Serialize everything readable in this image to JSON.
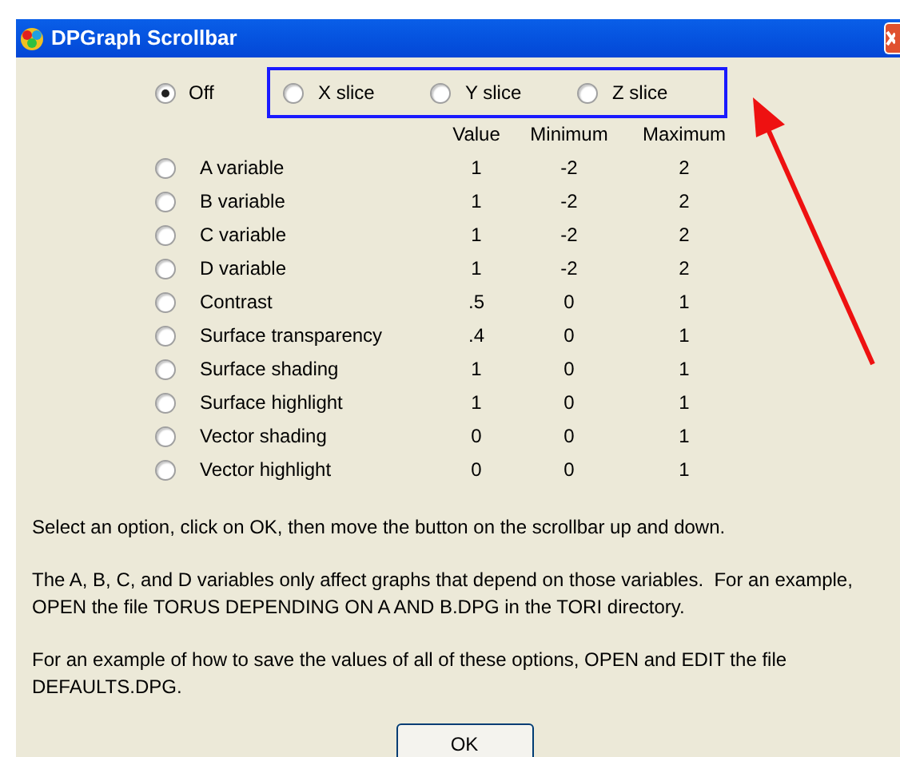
{
  "window": {
    "title": "DPGraph Scrollbar"
  },
  "off_option": {
    "label": "Off",
    "selected": true
  },
  "slice_options": [
    {
      "label": "X slice",
      "selected": false
    },
    {
      "label": "Y slice",
      "selected": false
    },
    {
      "label": "Z slice",
      "selected": false
    }
  ],
  "table": {
    "columns": [
      "Value",
      "Minimum",
      "Maximum"
    ],
    "rows": [
      {
        "label": "A variable",
        "selected": false,
        "value": "1",
        "minimum": "-2",
        "maximum": "2"
      },
      {
        "label": "B variable",
        "selected": false,
        "value": "1",
        "minimum": "-2",
        "maximum": "2"
      },
      {
        "label": "C variable",
        "selected": false,
        "value": "1",
        "minimum": "-2",
        "maximum": "2"
      },
      {
        "label": "D variable",
        "selected": false,
        "value": "1",
        "minimum": "-2",
        "maximum": "2"
      },
      {
        "label": "Contrast",
        "selected": false,
        "value": ".5",
        "minimum": "0",
        "maximum": "1"
      },
      {
        "label": "Surface transparency",
        "selected": false,
        "value": ".4",
        "minimum": "0",
        "maximum": "1"
      },
      {
        "label": "Surface shading",
        "selected": false,
        "value": "1",
        "minimum": "0",
        "maximum": "1"
      },
      {
        "label": "Surface highlight",
        "selected": false,
        "value": "1",
        "minimum": "0",
        "maximum": "1"
      },
      {
        "label": "Vector shading",
        "selected": false,
        "value": "0",
        "minimum": "0",
        "maximum": "1"
      },
      {
        "label": "Vector highlight",
        "selected": false,
        "value": "0",
        "minimum": "0",
        "maximum": "1"
      }
    ]
  },
  "paragraphs": [
    "Select an option, click on OK, then move the button on the scrollbar up and down.",
    "The A, B, C, and D variables only affect graphs that depend on those variables.  For an example, OPEN the file TORUS DEPENDING ON A AND B.DPG in the TORI directory.",
    "For an example of how to save the values of all of these options, OPEN and EDIT the file DEFAULTS.DPG."
  ],
  "buttons": [
    "OK"
  ]
}
